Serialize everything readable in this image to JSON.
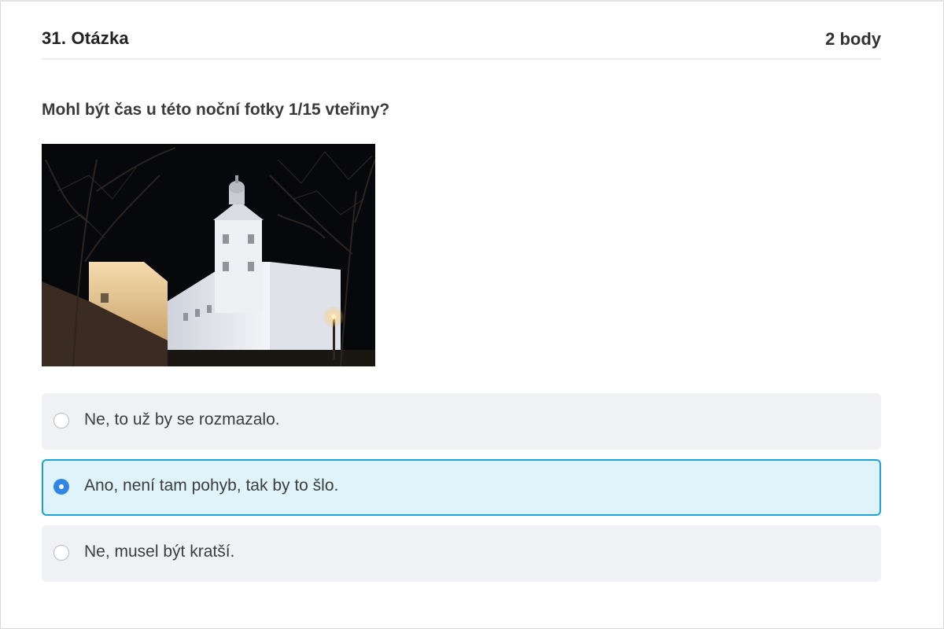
{
  "question": {
    "number_label": "31. Otázka",
    "points_label": "2 body",
    "text": "Mohl být čas u této noční fotky 1/15 vteřiny?",
    "image": {
      "subject": "night-photo-baroque-building",
      "palette": {
        "sky": "#07080c",
        "building_light": "#e9ebf0",
        "warm_light": "#f3d7a6",
        "lamp": "#ffd27a"
      }
    },
    "answers": [
      {
        "label": "Ne, to už by se rozmazalo.",
        "selected": false
      },
      {
        "label": "Ano, není tam pohyb, tak by to šlo.",
        "selected": true
      },
      {
        "label": "Ne, musel být kratší.",
        "selected": false
      }
    ]
  },
  "colors": {
    "answer_bg": "#eff1f4",
    "selected_bg": "#dff3fb",
    "selected_border": "#1ea0dc",
    "radio_selected": "#2f86e6",
    "divider": "#ececec"
  }
}
